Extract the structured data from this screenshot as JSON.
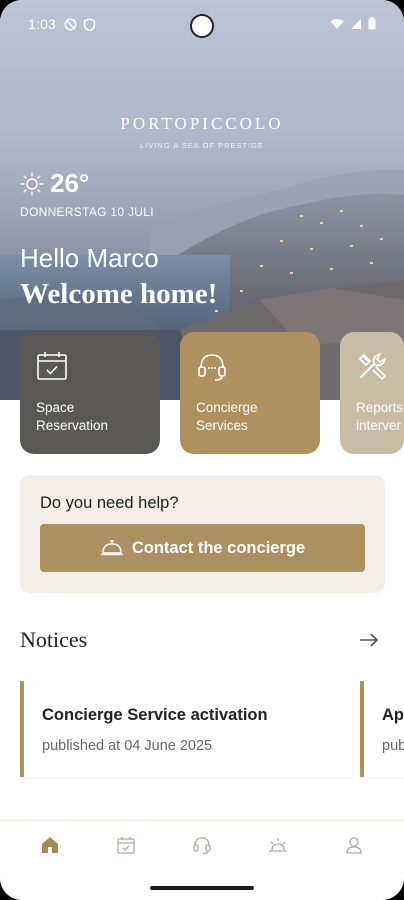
{
  "status_bar": {
    "time": "1:03"
  },
  "hero": {
    "brand": "PORTOPICCOLO",
    "tagline": "LIVING A SEA OF PRESTIGE",
    "temperature": "26°",
    "date": "DONNERSTAG 10 JULI",
    "greeting": "Hello Marco",
    "welcome": "Welcome home!"
  },
  "service_cards": [
    {
      "label_line1": "Space",
      "label_line2": "Reservation",
      "icon": "calendar-check-icon",
      "color": "#5a5856"
    },
    {
      "label_line1": "Concierge",
      "label_line2": "Services",
      "icon": "headset-icon",
      "color": "#ad9260"
    },
    {
      "label_line1": "Reports",
      "label_line2": "interver",
      "icon": "tools-icon",
      "color": "#c9bca7"
    }
  ],
  "help": {
    "question": "Do you need help?",
    "button_label": "Contact the concierge"
  },
  "notices": {
    "title": "Notices",
    "items": [
      {
        "title": "Concierge Service activation",
        "date": "published at 04 June 2025"
      },
      {
        "title": "Ap",
        "date": "pub"
      }
    ]
  },
  "bottom_nav": [
    {
      "icon": "home-icon",
      "active": true
    },
    {
      "icon": "calendar-icon",
      "active": false
    },
    {
      "icon": "headset-icon",
      "active": false
    },
    {
      "icon": "sunrise-icon",
      "active": false
    },
    {
      "icon": "profile-icon",
      "active": false
    }
  ],
  "colors": {
    "accent": "#ad9260",
    "dark_card": "#5a5856",
    "beige_card": "#c9bca7",
    "help_bg": "#f3efe8"
  }
}
